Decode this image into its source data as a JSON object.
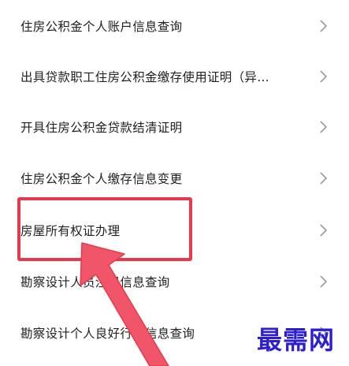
{
  "menu": {
    "items": [
      {
        "label": "住房公积金个人账户信息查询"
      },
      {
        "label": "出具贷款职工住房公积金缴存使用证明（异…"
      },
      {
        "label": "开具住房公积金贷款结清证明"
      },
      {
        "label": "住房公积金个人缴存信息变更"
      },
      {
        "label": "房屋所有权证办理"
      },
      {
        "label": "勘察设计人员注册信息查询"
      },
      {
        "label": "勘察设计个人良好行为信息查询"
      }
    ]
  },
  "annotation": {
    "highlight_color": "#e8394a",
    "arrow_color": "#f0556a"
  },
  "watermark": {
    "text": "最需网",
    "color": "#2d1fd1"
  },
  "icons": {
    "chevron": "chevron-right-icon"
  }
}
